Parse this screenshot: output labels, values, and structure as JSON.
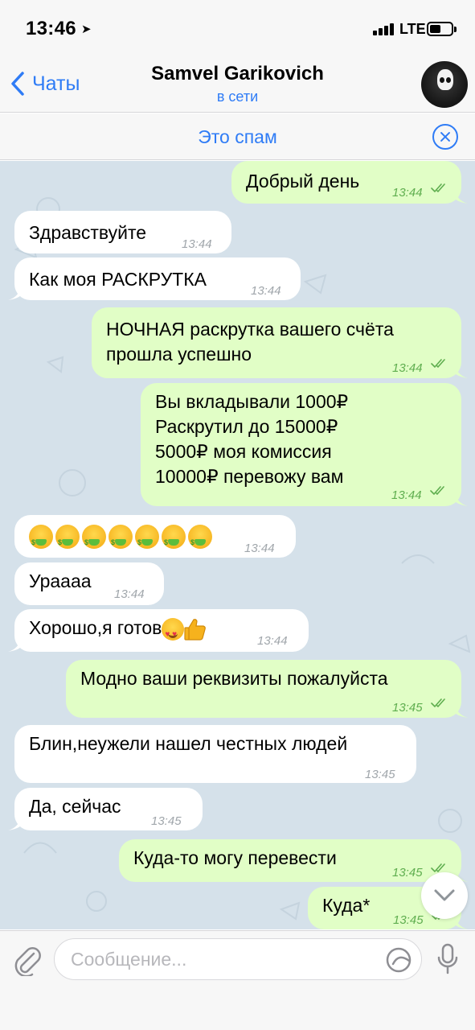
{
  "status_bar": {
    "time": "13:46",
    "network": "LTE"
  },
  "nav": {
    "back_label": "Чаты",
    "title": "Samvel Garikovich",
    "status": "в сети"
  },
  "spam_bar": {
    "label": "Это спам"
  },
  "messages": [
    {
      "dir": "out",
      "text": "Добрый день",
      "time": "13:44"
    },
    {
      "dir": "in",
      "text": "Здравствуйте",
      "time": "13:44"
    },
    {
      "dir": "in",
      "text": "Как моя РАСКРУТКА",
      "time": "13:44"
    },
    {
      "dir": "out",
      "text": "НОЧНАЯ раскрутка вашего счёта\nпрошла успешно",
      "time": "13:44"
    },
    {
      "dir": "out",
      "text": "Вы вкладывали 1000₽\nРаскрутил до 15000₽\n5000₽ моя комиссия\n10000₽ перевожу вам",
      "time": "13:44"
    },
    {
      "dir": "in",
      "text": "🤑🤑🤑🤑🤑🤑🤑",
      "time": "13:44"
    },
    {
      "dir": "in",
      "text": "Ураааа",
      "time": "13:44"
    },
    {
      "dir": "in",
      "text": "Хорошо,я готов😍👍",
      "time": "13:44"
    },
    {
      "dir": "out",
      "text": "Модно ваши реквизиты пожалуйста",
      "time": "13:45"
    },
    {
      "dir": "in",
      "text": "Блин,неужели нашел честных людей",
      "time": "13:45"
    },
    {
      "dir": "in",
      "text": "Да, сейчас",
      "time": "13:45"
    },
    {
      "dir": "out",
      "text": "Куда-то могу перевести",
      "time": "13:45"
    },
    {
      "dir": "out",
      "text": "Куда*",
      "time": "13:45"
    }
  ],
  "input": {
    "placeholder": "Сообщение..."
  },
  "colors": {
    "accent": "#2f7cf6",
    "incoming_bubble": "#ffffff",
    "outgoing_bubble": "#e1fec6",
    "chat_bg": "#d5e1ea",
    "read_check": "#5fae4f"
  },
  "icons": [
    "location-arrow-icon",
    "signal-icon",
    "battery-icon",
    "back-chevron-icon",
    "close-circle-icon",
    "double-check-icon",
    "chevron-down-icon",
    "paperclip-icon",
    "sticker-icon",
    "microphone-icon"
  ]
}
